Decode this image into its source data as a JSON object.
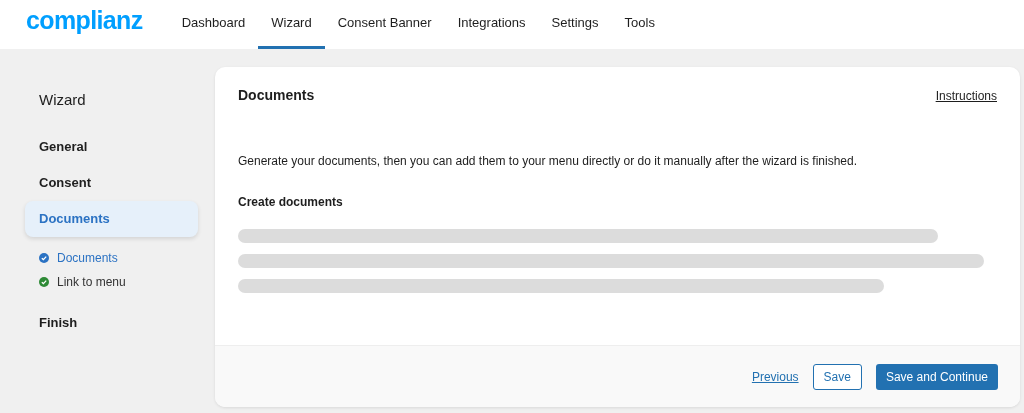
{
  "logo": "complianz",
  "nav": [
    {
      "label": "Dashboard",
      "selected": false
    },
    {
      "label": "Wizard",
      "selected": true
    },
    {
      "label": "Consent Banner",
      "selected": false
    },
    {
      "label": "Integrations",
      "selected": false
    },
    {
      "label": "Settings",
      "selected": false
    },
    {
      "label": "Tools",
      "selected": false
    }
  ],
  "sidebar": {
    "title": "Wizard",
    "steps": [
      {
        "label": "General",
        "selected": false
      },
      {
        "label": "Consent",
        "selected": false
      },
      {
        "label": "Documents",
        "selected": true,
        "children": [
          {
            "label": "Documents",
            "selected": true,
            "color": "#2b72c3"
          },
          {
            "label": "Link to menu",
            "selected": false,
            "color": "#2e8a36"
          }
        ]
      },
      {
        "label": "Finish",
        "selected": false
      }
    ]
  },
  "card": {
    "title": "Documents",
    "link": "Instructions",
    "description": "Generate your documents, then you can add them to your menu directly or do it manually after the wizard is finished.",
    "section": "Create documents",
    "footer": {
      "previous": "Previous",
      "save": "Save",
      "continue": "Save and Continue"
    }
  }
}
